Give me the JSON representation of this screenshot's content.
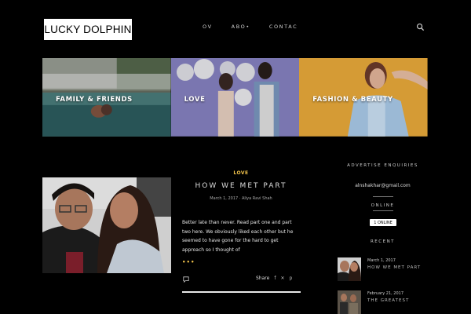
{
  "header": {
    "logo": "LUCKY DOLPHIN",
    "nav": [
      "OV",
      "ABO•",
      "CONTAC"
    ]
  },
  "tiles": [
    {
      "label": "FAMILY & FRIENDS"
    },
    {
      "label": "LOVE"
    },
    {
      "label": "FASHION & BEAUTY"
    }
  ],
  "post": {
    "category": "LOVE",
    "title": "HOW WE MET PART",
    "meta": "March 1, 2017  ·  Aliya Ravi Shah",
    "excerpt": "Better late than never. Read part one and part two here.  We obviously liked each other but he seemed to have gone for the hard to get approach so I thought of",
    "read_more": "•••",
    "share_label": "Share",
    "share_icons": [
      "f",
      "✕",
      "p"
    ]
  },
  "sidebar": {
    "contact_heading": "ADVERTISE ENQUIRIES",
    "email": "alnshakhar@gmail.com",
    "status_heading": "ONLINE",
    "online_badge": "1 ONLINE",
    "recent_heading": "RECENT",
    "recent": [
      {
        "date": "March 1, 2017",
        "title": "HOW WE MET PART"
      },
      {
        "date": "February 21, 2017",
        "title": "THE GREATEST"
      }
    ]
  },
  "colors": {
    "background": "#000000",
    "accent": "#f0c24b",
    "tile_fashion_bg": "#e8a93a",
    "tile_love_bg": "#8b87c9"
  }
}
